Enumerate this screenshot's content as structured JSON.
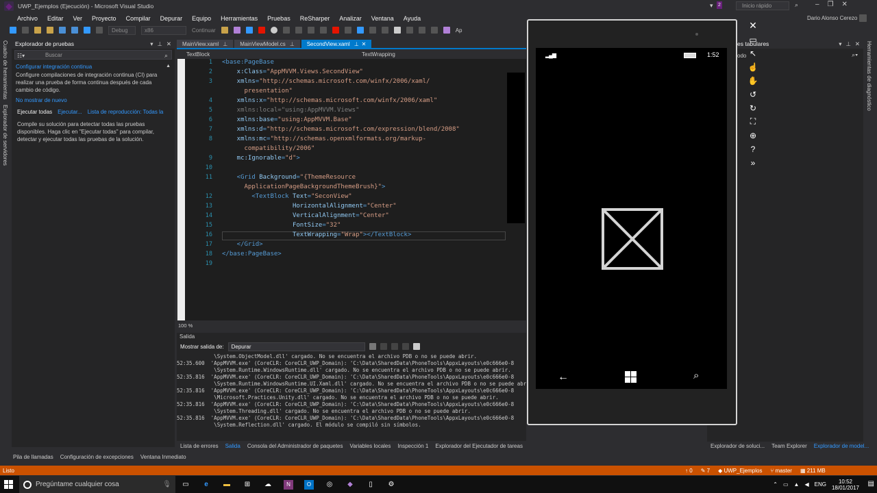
{
  "window": {
    "title": "UWP_Ejemplos (Ejecución) - Microsoft Visual Studio",
    "quick_launch": "Inicio rápido",
    "user": "Dario Alonso Cerezo",
    "notif_count": "2"
  },
  "menu": [
    "Archivo",
    "Editar",
    "Ver",
    "Proyecto",
    "Compilar",
    "Depurar",
    "Equipo",
    "Herramientas",
    "Pruebas",
    "ReSharper",
    "Analizar",
    "Ventana",
    "Ayuda"
  ],
  "toolbar": {
    "config": "Debug",
    "platform": "x86",
    "continue": "Continuar",
    "app": "Ap"
  },
  "left_vertical_tabs": [
    "Cuadro de herramientas",
    "Explorador de servidores"
  ],
  "test_explorer": {
    "title": "Explorador de pruebas",
    "search_placeholder": "Buscar",
    "ci_title": "Configurar integración continua",
    "ci_text": "Configure compilaciones de integración continua (CI) para realizar una prueba de forma continua después de cada cambio de código.",
    "dont_show": "No mostrar de nuevo",
    "run_all": "Ejecutar todas",
    "run": "Ejecutar...",
    "playlist": "Lista de reproducción: Todas la",
    "hint": "Compile su solución para detectar todas las pruebas disponibles. Haga clic en \"Ejecutar todas\" para compilar, detectar y ejecutar todas las pruebas de la solución."
  },
  "doc_tabs": [
    {
      "label": "MainView.xaml"
    },
    {
      "label": "MainViewModel.cs"
    },
    {
      "label": "SecondView.xaml",
      "active": true
    }
  ],
  "nav": {
    "left": "TextBlock",
    "right": "TextWrapping"
  },
  "code_lines": [
    {
      "n": "1",
      "segs": [
        [
          "tag",
          "<base:PageBase"
        ]
      ]
    },
    {
      "n": "2",
      "segs": [
        [
          "attr",
          "    x:Class"
        ],
        [
          "tag",
          "="
        ],
        [
          "str",
          "\"AppMVVM.Views.SecondView\""
        ]
      ]
    },
    {
      "n": "3",
      "segs": [
        [
          "attr",
          "    xmlns"
        ],
        [
          "tag",
          "="
        ],
        [
          "str",
          "\"http://schemas.microsoft.com/winfx/2006/xaml/"
        ]
      ]
    },
    {
      "n": "",
      "segs": [
        [
          "str",
          "      presentation\""
        ]
      ]
    },
    {
      "n": "4",
      "segs": [
        [
          "attr",
          "    xmlns:x"
        ],
        [
          "tag",
          "="
        ],
        [
          "str",
          "\"http://schemas.microsoft.com/winfx/2006/xaml\""
        ]
      ]
    },
    {
      "n": "5",
      "segs": [
        [
          "gray",
          "    xmlns:local=\"using:AppMVVM.Views\""
        ]
      ]
    },
    {
      "n": "6",
      "segs": [
        [
          "attr",
          "    xmlns:base"
        ],
        [
          "tag",
          "="
        ],
        [
          "str",
          "\"using:AppMVVM.Base\""
        ]
      ]
    },
    {
      "n": "7",
      "segs": [
        [
          "attr",
          "    xmlns:d"
        ],
        [
          "tag",
          "="
        ],
        [
          "str",
          "\"http://schemas.microsoft.com/expression/blend/2008\""
        ]
      ]
    },
    {
      "n": "8",
      "segs": [
        [
          "attr",
          "    xmlns:mc"
        ],
        [
          "tag",
          "="
        ],
        [
          "str",
          "\"http://schemas.openxmlformats.org/markup-"
        ]
      ]
    },
    {
      "n": "",
      "segs": [
        [
          "str",
          "      compatibility/2006\""
        ]
      ]
    },
    {
      "n": "9",
      "segs": [
        [
          "attr",
          "    mc:Ignorable"
        ],
        [
          "tag",
          "="
        ],
        [
          "str",
          "\"d\""
        ],
        [
          "tag",
          ">"
        ]
      ]
    },
    {
      "n": "10",
      "segs": [
        [
          "tag",
          ""
        ]
      ]
    },
    {
      "n": "11",
      "segs": [
        [
          "tag",
          "    <Grid "
        ],
        [
          "attr",
          "Background"
        ],
        [
          "tag",
          "="
        ],
        [
          "str",
          "\"{ThemeResource"
        ]
      ]
    },
    {
      "n": "",
      "segs": [
        [
          "str",
          "      ApplicationPageBackgroundThemeBrush}\""
        ],
        [
          "tag",
          ">"
        ]
      ]
    },
    {
      "n": "12",
      "segs": [
        [
          "tag",
          "        <TextBlock "
        ],
        [
          "attr",
          "Text"
        ],
        [
          "tag",
          "="
        ],
        [
          "str",
          "\"SeconView\""
        ]
      ]
    },
    {
      "n": "13",
      "segs": [
        [
          "attr",
          "                   HorizontalAlignment"
        ],
        [
          "tag",
          "="
        ],
        [
          "str",
          "\"Center\""
        ]
      ]
    },
    {
      "n": "14",
      "segs": [
        [
          "attr",
          "                   VerticalAlignment"
        ],
        [
          "tag",
          "="
        ],
        [
          "str",
          "\"Center\""
        ]
      ]
    },
    {
      "n": "15",
      "segs": [
        [
          "attr",
          "                   FontSize"
        ],
        [
          "tag",
          "="
        ],
        [
          "str",
          "\"32\""
        ]
      ]
    },
    {
      "n": "16",
      "segs": [
        [
          "attr",
          "                   TextWrapping"
        ],
        [
          "tag",
          "="
        ],
        [
          "str",
          "\"Wrap\""
        ],
        [
          "tag",
          "></TextBlock>"
        ]
      ]
    },
    {
      "n": "17",
      "segs": [
        [
          "tag",
          "    </Grid>"
        ]
      ]
    },
    {
      "n": "18",
      "segs": [
        [
          "tag",
          "</base:PageBase>"
        ]
      ]
    },
    {
      "n": "19",
      "segs": [
        [
          "tag",
          ""
        ]
      ]
    }
  ],
  "zoom": "100 %",
  "output": {
    "title": "Salida",
    "show_from": "Mostrar salida de:",
    "source": "Depurar",
    "lines": [
      "            \\System.ObjectModel.dll' cargado. No se encuentra el archivo PDB o no se puede abrir.",
      "52:35.600  'AppMVVM.exe' (CoreCLR: CoreCLR_UWP_Domain): 'C:\\Data\\SharedData\\PhoneTools\\AppxLayouts\\e0c666e0-8",
      "            \\System.Runtime.WindowsRuntime.dll' cargado. No se encuentra el archivo PDB o no se puede abrir.",
      "52:35.816  'AppMVVM.exe' (CoreCLR: CoreCLR_UWP_Domain): 'C:\\Data\\SharedData\\PhoneTools\\AppxLayouts\\e0c666e0-8",
      "            \\System.Runtime.WindowsRuntime.UI.Xaml.dll' cargado. No se encuentra el archivo PDB o no se puede abrir.",
      "52:35.816  'AppMVVM.exe' (CoreCLR: CoreCLR_UWP_Domain): 'C:\\Data\\SharedData\\PhoneTools\\AppxLayouts\\e0c666e0-8",
      "            \\Microsoft.Practices.Unity.dll' cargado. No se encuentra el archivo PDB o no se puede abrir.",
      "52:35.816  'AppMVVM.exe' (CoreCLR: CoreCLR_UWP_Domain): 'C:\\Data\\SharedData\\PhoneTools\\AppxLayouts\\e0c666e0-8",
      "            \\System.Threading.dll' cargado. No se encuentra el archivo PDB o no se puede abrir.",
      "52:35.816  'AppMVVM.exe' (CoreCLR: CoreCLR_UWP_Domain): 'C:\\Data\\SharedData\\PhoneTools\\AppxLayouts\\e0c666e0-8",
      "            \\System.Reflection.dll' cargado. El módulo se compiló sin símbolos."
    ]
  },
  "bottom_tabs": [
    "Lista de errores",
    "Salida",
    "Consola del Administrador de paquetes",
    "Variables locales",
    "Inspección 1",
    "Explorador del Ejecutador de tareas"
  ],
  "bottom_left_tabs": [
    "Pila de llamadas",
    "Configuración de excepciones",
    "Ventana Inmediato"
  ],
  "right_tabs": [
    "Explorador de soluci...",
    "Team Explorer",
    "Explorador de model..."
  ],
  "right_panel": {
    "title": "es tabulares",
    "sub": "odo"
  },
  "right_vertical": "Herramientas de diagnóstico",
  "status": {
    "left": "Listo",
    "up": "0",
    "edits": "7",
    "project": "UWP_Ejemplos",
    "branch": "master",
    "mem": "211 MB"
  },
  "phone": {
    "time": "1:52"
  },
  "taskbar": {
    "search": "Pregúntame cualquier cosa",
    "lang": "ENG",
    "time": "10:52",
    "date": "18/01/2017"
  },
  "colors": {
    "accent": "#007acc",
    "status": "#ca5100"
  }
}
